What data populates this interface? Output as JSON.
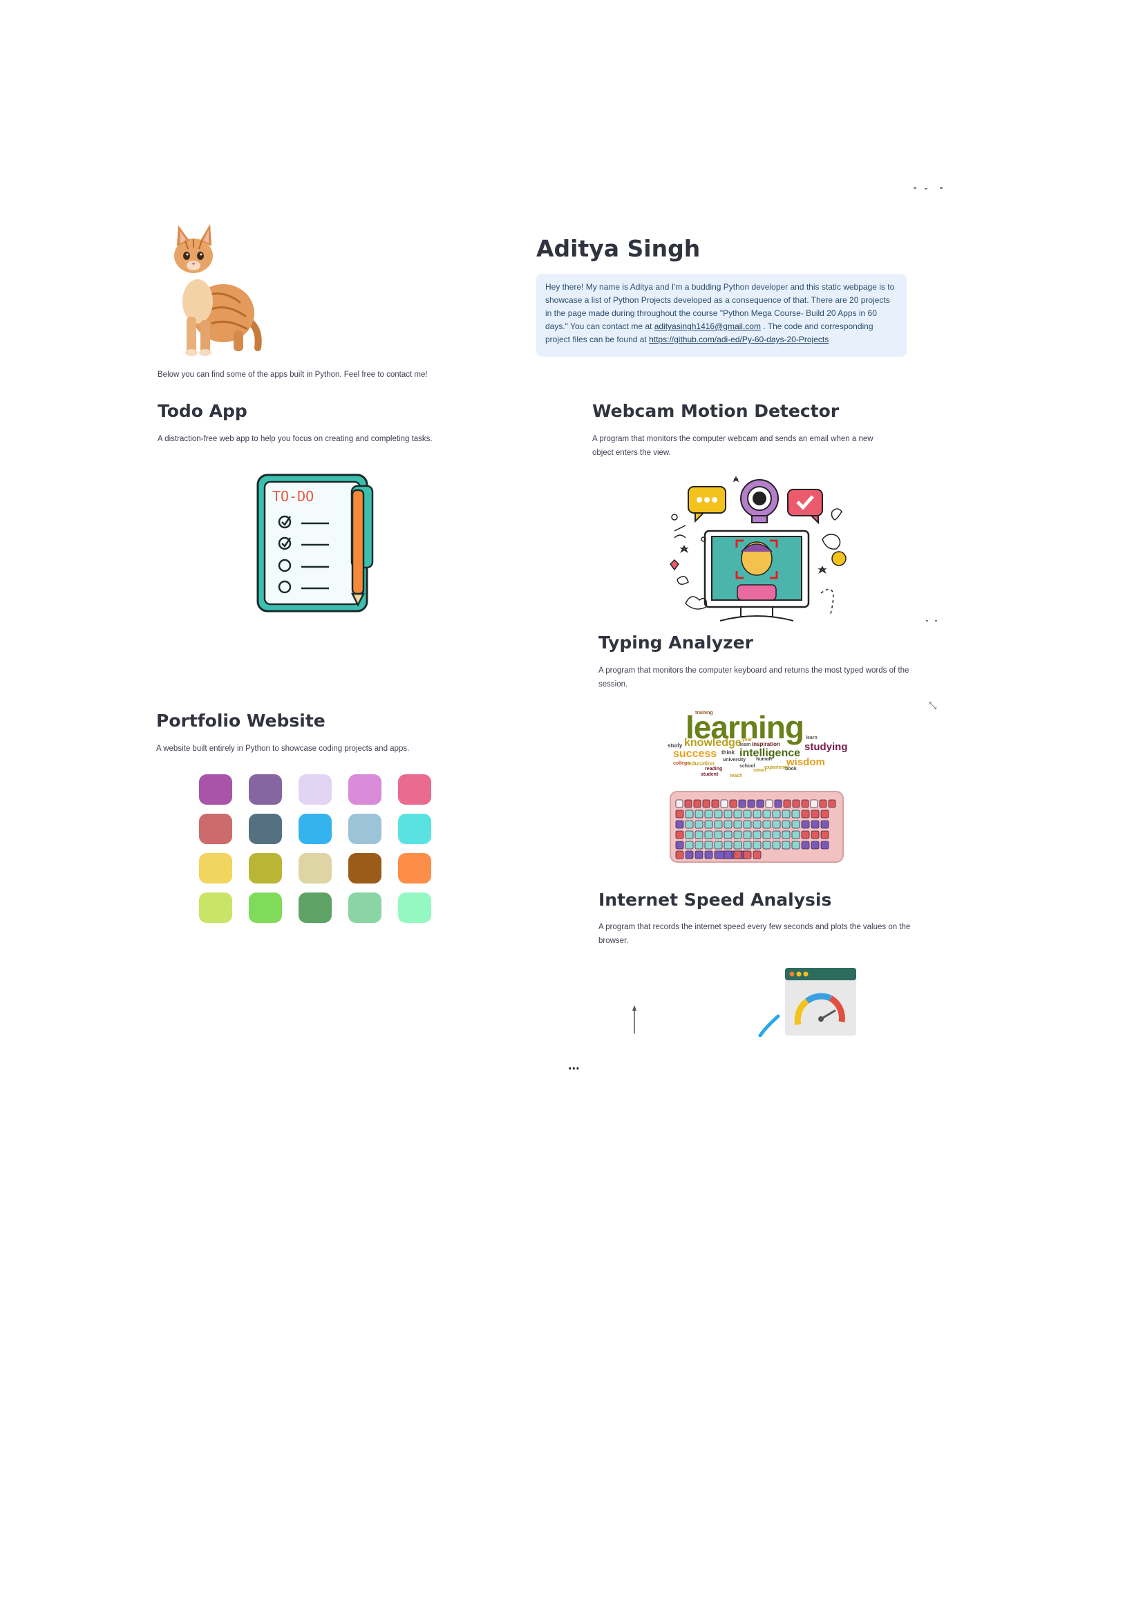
{
  "profile": {
    "name": "Aditya Singh",
    "intro_caption": "Below you can find some of the apps built in Python. Feel free to contact me!",
    "about_part1": "Hey there! My name is Aditya and I'm a budding Python developer and this static webpage is to showcase a list of Python Projects developed as a consequence of that. There are 20 projects in the page made during throughout the course \"Python Mega Course- Build 20 Apps in 60 days.\" You can contact me at ",
    "email": "adityasingh1416@gmail.com",
    "about_part2": " . The code and corresponding project files can be found at ",
    "repo_url": "https://github.com/adi-ed/Py-60-days-20-Projects"
  },
  "projects": [
    {
      "title": "Todo App",
      "description": "A distraction-free web app to help you focus on creating and completing tasks.",
      "image_icon": "todo-list-icon"
    },
    {
      "title": "Webcam Motion Detector",
      "description": "A program that monitors the computer webcam and sends an email when a new object enters the view.",
      "image_icon": "webcam-monitor-icon"
    },
    {
      "title": "Typing Analyzer",
      "description": "A program that monitors the computer keyboard and returns the most typed words of the session.",
      "image_icon": "keyboard-wordcloud-icon"
    },
    {
      "title": "Portfolio Website",
      "description": "A website built entirely in Python to showcase coding projects and apps.",
      "image_icon": "color-palette-icon"
    },
    {
      "title": "Internet Speed Analysis",
      "description": "A program that records the internet speed every few seconds and plots the values on the browser.",
      "image_icon": "speedometer-icon"
    }
  ],
  "todo_image": {
    "header": "TO-DO"
  },
  "wordcloud": {
    "words": [
      "training",
      "learning",
      "study",
      "knowledge",
      "year",
      "learn",
      "team",
      "inspiration",
      "studying",
      "success",
      "think",
      "intelligence",
      "college",
      "education",
      "university",
      "human",
      "wisdom",
      "reading",
      "school",
      "book",
      "student",
      "textbook",
      "smart",
      "teach",
      "learning",
      "experience"
    ]
  },
  "palette": {
    "rows": [
      [
        "#a855a8",
        "#8566a0",
        "#e2d4f3",
        "#d98ad9",
        "#e96b8e"
      ],
      [
        "#cc6b6b",
        "#557080",
        "#35b3ef",
        "#9dc3d8",
        "#5ae2e2"
      ],
      [
        "#f0d65e",
        "#bab535",
        "#ddd5a4",
        "#9c5c19",
        "#fd8e49"
      ],
      [
        "#c9e467",
        "#7fdb59",
        "#5fa265",
        "#8bd4a3",
        "#94f8c2"
      ]
    ]
  },
  "more_indicator": "...",
  "icons": {
    "expand": "expand-icon"
  }
}
